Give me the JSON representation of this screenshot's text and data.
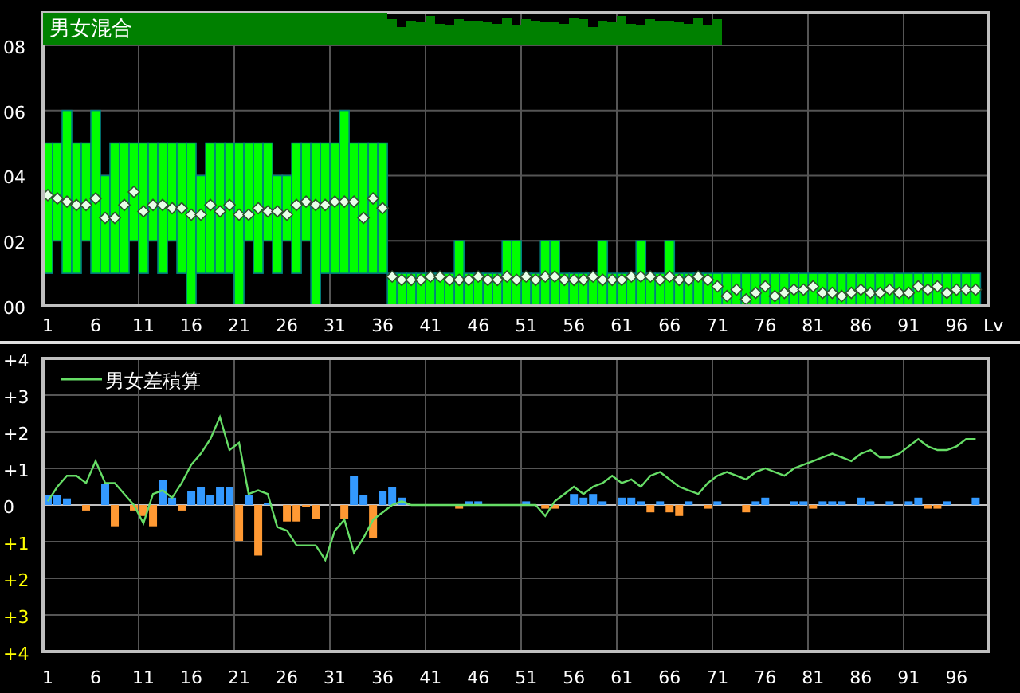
{
  "charts": [
    {
      "chart_data": {
        "type": "candlestick",
        "title": "男女混合",
        "xlabel": "Lv",
        "grid": true,
        "x": [
          1,
          2,
          3,
          4,
          5,
          6,
          7,
          8,
          9,
          10,
          11,
          12,
          13,
          14,
          15,
          16,
          17,
          18,
          19,
          20,
          21,
          22,
          23,
          24,
          25,
          26,
          27,
          28,
          29,
          30,
          31,
          32,
          33,
          34,
          35,
          36,
          37,
          38,
          39,
          40,
          41,
          42,
          43,
          44,
          45,
          46,
          47,
          48,
          49,
          50,
          51,
          52,
          53,
          54,
          55,
          56,
          57,
          58,
          59,
          60,
          61,
          62,
          63,
          64,
          65,
          66,
          67,
          68,
          69,
          70,
          71,
          72,
          73,
          74,
          75,
          76,
          77,
          78,
          79,
          80,
          81,
          82,
          83,
          84,
          85,
          86,
          87,
          88,
          89,
          90,
          91,
          92,
          93,
          94,
          95,
          96,
          97,
          98
        ],
        "series": [
          {
            "color": "#00ff00",
            "ohlc": [
              [
                1,
                5,
                1,
                5
              ],
              [
                2,
                5,
                2,
                5
              ],
              [
                1,
                6,
                1,
                6
              ],
              [
                1,
                5,
                1,
                5
              ],
              [
                2,
                5,
                2,
                5
              ],
              [
                1,
                6,
                1,
                6
              ],
              [
                1,
                4,
                1,
                4
              ],
              [
                1,
                5,
                1,
                5
              ],
              [
                1,
                5,
                1,
                5
              ],
              [
                2,
                5,
                2,
                5
              ],
              [
                1,
                5,
                1,
                5
              ],
              [
                2,
                5,
                2,
                5
              ],
              [
                1,
                5,
                1,
                5
              ],
              [
                2,
                5,
                2,
                5
              ],
              [
                1,
                5,
                1,
                5
              ],
              [
                0,
                5,
                0,
                5
              ],
              [
                1,
                4,
                1,
                4
              ],
              [
                1,
                5,
                1,
                5
              ],
              [
                1,
                5,
                1,
                5
              ],
              [
                1,
                5,
                1,
                5
              ],
              [
                0,
                5,
                0,
                5
              ],
              [
                2,
                5,
                2,
                5
              ],
              [
                1,
                5,
                1,
                5
              ],
              [
                2,
                5,
                2,
                5
              ],
              [
                1,
                4,
                1,
                4
              ],
              [
                2,
                4,
                2,
                4
              ],
              [
                1,
                5,
                1,
                5
              ],
              [
                2,
                5,
                2,
                5
              ],
              [
                0,
                5,
                0,
                5
              ],
              [
                1,
                5,
                1,
                5
              ],
              [
                1,
                5,
                1,
                5
              ],
              [
                1,
                6,
                1,
                6
              ],
              [
                1,
                5,
                1,
                5
              ],
              [
                1,
                5,
                1,
                5
              ],
              [
                1,
                5,
                1,
                5
              ],
              [
                1,
                5,
                1,
                5
              ],
              [
                0,
                1,
                0,
                1
              ],
              [
                0,
                1,
                0,
                1
              ],
              [
                0,
                1,
                0,
                1
              ],
              [
                0,
                1,
                0,
                1
              ],
              [
                0,
                1,
                0,
                1
              ],
              [
                0,
                1,
                0,
                1
              ],
              [
                0,
                1,
                0,
                1
              ],
              [
                0,
                2,
                0,
                2
              ],
              [
                0,
                1,
                0,
                1
              ],
              [
                0,
                1,
                0,
                1
              ],
              [
                0,
                1,
                0,
                1
              ],
              [
                0,
                1,
                0,
                1
              ],
              [
                0,
                2,
                0,
                2
              ],
              [
                0,
                2,
                0,
                2
              ],
              [
                0,
                1,
                0,
                1
              ],
              [
                0,
                1,
                0,
                1
              ],
              [
                0,
                2,
                0,
                2
              ],
              [
                0,
                2,
                0,
                2
              ],
              [
                0,
                1,
                0,
                1
              ],
              [
                0,
                1,
                0,
                1
              ],
              [
                0,
                1,
                0,
                1
              ],
              [
                0,
                1,
                0,
                1
              ],
              [
                0,
                2,
                0,
                2
              ],
              [
                0,
                1,
                0,
                1
              ],
              [
                0,
                1,
                0,
                1
              ],
              [
                0,
                1,
                0,
                1
              ],
              [
                0,
                2,
                0,
                2
              ],
              [
                0,
                1,
                0,
                1
              ],
              [
                0,
                1,
                0,
                1
              ],
              [
                0,
                2,
                0,
                2
              ],
              [
                0,
                1,
                0,
                1
              ],
              [
                0,
                1,
                0,
                1
              ],
              [
                0,
                1,
                0,
                1
              ],
              [
                0,
                1,
                0,
                1
              ],
              [
                0,
                1,
                0,
                1
              ],
              [
                0,
                1,
                0,
                1
              ],
              [
                0,
                1,
                0,
                1
              ],
              [
                0,
                1,
                0,
                1
              ],
              [
                0,
                1,
                0,
                1
              ],
              [
                0,
                1,
                0,
                1
              ],
              [
                0,
                1,
                0,
                1
              ],
              [
                0,
                1,
                0,
                1
              ],
              [
                0,
                1,
                0,
                1
              ],
              [
                0,
                1,
                0,
                1
              ],
              [
                0,
                1,
                0,
                1
              ],
              [
                0,
                1,
                0,
                1
              ],
              [
                0,
                1,
                0,
                1
              ],
              [
                0,
                1,
                0,
                1
              ],
              [
                0,
                1,
                0,
                1
              ],
              [
                0,
                1,
                0,
                1
              ],
              [
                0,
                1,
                0,
                1
              ],
              [
                0,
                1,
                0,
                1
              ],
              [
                0,
                1,
                0,
                1
              ],
              [
                0,
                1,
                0,
                1
              ],
              [
                0,
                1,
                0,
                1
              ],
              [
                0,
                1,
                0,
                1
              ],
              [
                0,
                1,
                0,
                1
              ],
              [
                0,
                1,
                0,
                1
              ],
              [
                0,
                1,
                0,
                1
              ],
              [
                0,
                1,
                0,
                1
              ],
              [
                0,
                1,
                0,
                1
              ],
              [
                0,
                1,
                0,
                1
              ]
            ]
          },
          {
            "type": "scatter",
            "color": "#e8ffe8",
            "values": [
              3.4,
              3.3,
              3.2,
              3.1,
              3.1,
              3.3,
              2.7,
              2.7,
              3.1,
              3.5,
              2.9,
              3.1,
              3.1,
              3.0,
              3.0,
              2.8,
              2.8,
              3.1,
              2.9,
              3.1,
              2.8,
              2.8,
              3.0,
              2.9,
              2.9,
              2.8,
              3.1,
              3.2,
              3.1,
              3.1,
              3.2,
              3.2,
              3.2,
              2.7,
              3.3,
              3.0,
              0.9,
              0.8,
              0.8,
              0.8,
              0.9,
              0.9,
              0.8,
              0.8,
              0.8,
              0.9,
              0.8,
              0.8,
              0.9,
              0.8,
              0.9,
              0.8,
              0.9,
              0.9,
              0.8,
              0.8,
              0.8,
              0.9,
              0.8,
              0.8,
              0.8,
              0.9,
              0.9,
              0.9,
              0.8,
              0.9,
              0.8,
              0.8,
              0.9,
              0.8,
              0.6,
              0.3,
              0.5,
              0.2,
              0.4,
              0.6,
              0.3,
              0.4,
              0.5,
              0.5,
              0.6,
              0.4,
              0.4,
              0.3,
              0.4,
              0.5,
              0.4,
              0.4,
              0.5,
              0.4,
              0.4,
              0.6,
              0.5,
              0.6,
              0.4,
              0.5,
              0.5,
              0.5
            ]
          }
        ],
        "xlim": [
          0.5,
          99.3
        ],
        "ylim": [
          0,
          9
        ],
        "yticks": [
          {
            "value": 8,
            "label": "08"
          },
          {
            "value": 6,
            "label": "06"
          },
          {
            "value": 4,
            "label": "04"
          },
          {
            "value": 2,
            "label": "02"
          },
          {
            "value": 0,
            "label": "00"
          }
        ],
        "xticks": [
          1,
          6,
          11,
          16,
          21,
          26,
          31,
          36,
          41,
          46,
          51,
          56,
          61,
          66,
          71,
          76,
          81,
          86,
          91,
          96
        ]
      }
    },
    {
      "chart_data": {
        "type": "bar",
        "grid": true,
        "x": [
          1,
          2,
          3,
          4,
          5,
          6,
          7,
          8,
          9,
          10,
          11,
          12,
          13,
          14,
          15,
          16,
          17,
          18,
          19,
          20,
          21,
          22,
          23,
          24,
          25,
          26,
          27,
          28,
          29,
          30,
          31,
          32,
          33,
          34,
          35,
          36,
          37,
          38,
          39,
          40,
          41,
          42,
          43,
          44,
          45,
          46,
          47,
          48,
          49,
          50,
          51,
          52,
          53,
          54,
          55,
          56,
          57,
          58,
          59,
          60,
          61,
          62,
          63,
          64,
          65,
          66,
          67,
          68,
          69,
          70,
          71,
          72,
          73,
          74,
          75,
          76,
          77,
          78,
          79,
          80,
          81,
          82,
          83,
          84,
          85,
          86,
          87,
          88,
          89,
          90,
          91,
          92,
          93,
          94,
          95,
          96,
          97,
          98
        ],
        "series": [
          {
            "color": "#3399ff",
            "values": [
              0.28,
              0.28,
              0.18,
              null,
              null,
              null,
              0.58,
              null,
              null,
              null,
              null,
              null,
              0.68,
              0.2,
              null,
              0.38,
              0.5,
              0.28,
              0.5,
              0.5,
              null,
              0.28,
              null,
              0.05,
              null,
              null,
              null,
              null,
              null,
              null,
              null,
              null,
              0.8,
              0.28,
              null,
              0.38,
              0.5,
              0.2,
              null,
              null,
              null,
              null,
              null,
              null,
              0.1,
              0.1,
              null,
              null,
              null,
              null,
              0.1,
              null,
              null,
              null,
              null,
              0.3,
              0.2,
              0.3,
              0.1,
              null,
              0.2,
              0.2,
              0.1,
              null,
              0.1,
              null,
              null,
              0.1,
              null,
              null,
              0.1,
              null,
              null,
              null,
              0.1,
              0.2,
              null,
              null,
              0.1,
              0.1,
              null,
              0.1,
              0.1,
              0.1,
              null,
              0.2,
              0.1,
              null,
              0.1,
              null,
              0.1,
              0.2,
              null,
              null,
              0.1,
              null,
              null,
              0.2
            ]
          },
          {
            "color": "#ff9933",
            "values": [
              null,
              null,
              null,
              null,
              -0.15,
              null,
              null,
              -0.58,
              null,
              -0.15,
              -0.3,
              -0.58,
              null,
              null,
              -0.15,
              null,
              null,
              null,
              null,
              null,
              -0.98,
              null,
              -1.38,
              null,
              null,
              -0.45,
              -0.45,
              -0.05,
              -0.38,
              null,
              null,
              -0.38,
              null,
              null,
              -0.9,
              null,
              null,
              null,
              null,
              null,
              null,
              null,
              null,
              -0.1,
              null,
              null,
              null,
              null,
              null,
              null,
              null,
              null,
              -0.1,
              -0.1,
              null,
              null,
              null,
              null,
              null,
              null,
              null,
              null,
              null,
              -0.2,
              null,
              -0.2,
              -0.3,
              null,
              null,
              -0.1,
              null,
              null,
              null,
              -0.2,
              null,
              null,
              null,
              null,
              null,
              null,
              -0.1,
              null,
              null,
              null,
              null,
              null,
              null,
              null,
              null,
              null,
              null,
              null,
              -0.1,
              -0.1,
              null,
              null,
              null,
              null
            ]
          },
          {
            "name": "男女差積算",
            "type": "line",
            "color": "#66dd66",
            "values": [
              0.1,
              0.5,
              0.8,
              0.8,
              0.6,
              1.2,
              0.6,
              0.6,
              0.3,
              0,
              -0.5,
              0.3,
              0.4,
              0.2,
              0.6,
              1.1,
              1.4,
              1.8,
              2.4,
              1.5,
              1.7,
              0.3,
              0.4,
              0.3,
              -0.6,
              -0.7,
              -1.1,
              -1.1,
              -1.1,
              -1.5,
              -0.7,
              -0.4,
              -1.3,
              -0.9,
              -0.4,
              -0.2,
              0,
              0.1,
              0,
              0,
              0,
              0,
              0,
              0,
              0,
              0,
              0,
              0,
              0,
              0,
              0,
              0,
              -0.3,
              0.1,
              0.3,
              0.5,
              0.3,
              0.5,
              0.6,
              0.8,
              0.6,
              0.7,
              0.5,
              0.8,
              0.9,
              0.7,
              0.5,
              0.4,
              0.3,
              0.6,
              0.8,
              0.9,
              0.8,
              0.7,
              0.9,
              1.0,
              0.9,
              0.8,
              1.0,
              1.1,
              1.2,
              1.3,
              1.4,
              1.3,
              1.2,
              1.4,
              1.5,
              1.3,
              1.3,
              1.4,
              1.6,
              1.8,
              1.6,
              1.5,
              1.5,
              1.6,
              1.8,
              1.8
            ]
          }
        ],
        "xlim": [
          0.5,
          99.3
        ],
        "ylim": [
          -4,
          4
        ],
        "yticks": [
          {
            "value": 4,
            "label": "+4"
          },
          {
            "value": 3,
            "label": "+3"
          },
          {
            "value": 2,
            "label": "+2"
          },
          {
            "value": 1,
            "label": "+1"
          },
          {
            "value": 0,
            "label": "0"
          },
          {
            "value": -1,
            "label": "+1"
          },
          {
            "value": -2,
            "label": "+2"
          },
          {
            "value": -3,
            "label": "+3"
          },
          {
            "value": -4,
            "label": "+4"
          }
        ],
        "xticks": [
          1,
          6,
          11,
          16,
          21,
          26,
          31,
          36,
          41,
          46,
          51,
          56,
          61,
          66,
          71,
          76,
          81,
          86,
          91,
          96
        ]
      }
    }
  ]
}
